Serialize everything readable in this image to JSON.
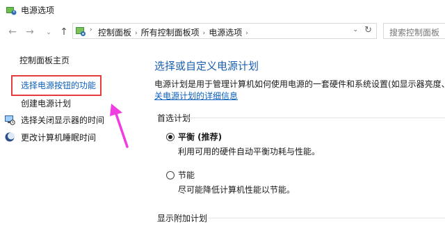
{
  "window": {
    "title": "电源选项"
  },
  "nav": {
    "back_glyph": "←",
    "forward_glyph": "→",
    "recent_glyph": "⌄",
    "up_glyph": "↑"
  },
  "address": {
    "crumbs": [
      "控制面板",
      "所有控制面板项",
      "电源选项"
    ],
    "separator": "›",
    "dropdown_glyph": "⌄",
    "refresh_glyph": "↻"
  },
  "search": {
    "placeholder": "搜索控制面板"
  },
  "sidebar": {
    "home": "控制面板主页",
    "items": [
      {
        "label": "选择电源按钮的功能"
      },
      {
        "label": "创建电源计划"
      },
      {
        "label": "选择关闭显示器的时间",
        "icon": "monitor-clock-icon"
      },
      {
        "label": "更改计算机睡眠时间",
        "icon": "moon-icon"
      }
    ]
  },
  "main": {
    "heading": "选择或自定义电源计划",
    "description": "电源计划是用于管理计算机如何使用电源的一套硬件和系统设置(如显示器亮度、",
    "details_link": "关电源计划的详细信息",
    "preferred_section": "首选计划",
    "extra_section": "显示附加计划",
    "plans": [
      {
        "name": "平衡 (推荐)",
        "description": "利用可用的硬件自动平衡功耗与性能。",
        "selected": true
      },
      {
        "name": "节能",
        "description": "尽可能降低计算机性能以节能。",
        "selected": false
      }
    ]
  },
  "colors": {
    "link": "#0b5fbd",
    "heading": "#1b5fb0",
    "highlight_box": "#e63b3b",
    "annotation_arrow": "#f03ce0"
  }
}
